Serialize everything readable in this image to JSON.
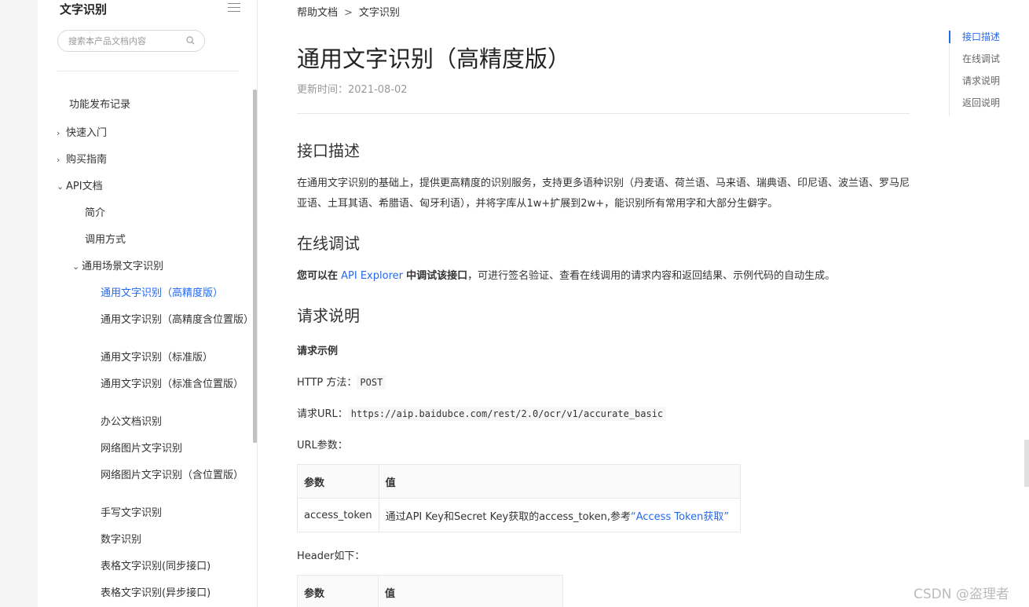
{
  "sidebar": {
    "title": "文字识别",
    "search_placeholder": "搜索本产品文档内容",
    "items": [
      {
        "label": "功能发布记录",
        "chev": ""
      },
      {
        "label": "快速入门",
        "chev": "›"
      },
      {
        "label": "购买指南",
        "chev": "›"
      },
      {
        "label": "API文档",
        "chev": "⌄"
      },
      {
        "label": "简介",
        "chev": ""
      },
      {
        "label": "调用方式",
        "chev": ""
      },
      {
        "label": "通用场景文字识别",
        "chev": "⌄"
      },
      {
        "label": "通用文字识别（高精度版）",
        "chev": ""
      },
      {
        "label": "通用文字识别（高精度含位置版）",
        "chev": ""
      },
      {
        "label": "通用文字识别（标准版）",
        "chev": ""
      },
      {
        "label": "通用文字识别（标准含位置版）",
        "chev": ""
      },
      {
        "label": "办公文档识别",
        "chev": ""
      },
      {
        "label": "网络图片文字识别",
        "chev": ""
      },
      {
        "label": "网络图片文字识别（含位置版）",
        "chev": ""
      },
      {
        "label": "手写文字识别",
        "chev": ""
      },
      {
        "label": "数字识别",
        "chev": ""
      },
      {
        "label": "表格文字识别(同步接口)",
        "chev": ""
      },
      {
        "label": "表格文字识别(异步接口)",
        "chev": ""
      }
    ]
  },
  "breadcrumb": {
    "root": "帮助文档",
    "sep": ">",
    "current": "文字识别"
  },
  "page": {
    "title": "通用文字识别（高精度版）",
    "updated": "更新时间：2021-08-02"
  },
  "sections": {
    "desc_heading": "接口描述",
    "desc_text": "在通用文字识别的基础上，提供更高精度的识别服务，支持更多语种识别（丹麦语、荷兰语、马来语、瑞典语、印尼语、波兰语、罗马尼亚语、土耳其语、希腊语、匈牙利语），并将字库从1w+扩展到2w+，能识别所有常用字和大部分生僻字。",
    "debug_heading": "在线调试",
    "debug_prefix": "您可以在",
    "debug_link": " API Explorer ",
    "debug_mid": "中调试该接口",
    "debug_suffix": "，可进行签名验证、查看在线调用的请求内容和返回结果、示例代码的自动生成。",
    "request_heading": "请求说明",
    "request_example": "请求示例",
    "http_method_label": "HTTP 方法：",
    "http_method": "POST",
    "url_label": "请求URL：",
    "url": "https://aip.baidubce.com/rest/2.0/ocr/v1/accurate_basic",
    "url_params_label": "URL参数：",
    "header_label": "Header如下："
  },
  "url_table": {
    "headers": [
      "参数",
      "值"
    ],
    "rows": [
      {
        "param": "access_token",
        "value_prefix": "通过API Key和Secret Key获取的access_token,参考",
        "value_link": "“Access Token获取”"
      }
    ]
  },
  "header_table": {
    "headers": [
      "参数",
      "值"
    ]
  },
  "toc": [
    "接口描述",
    "在线调试",
    "请求说明",
    "返回说明"
  ],
  "watermark": "CSDN @盗理者"
}
